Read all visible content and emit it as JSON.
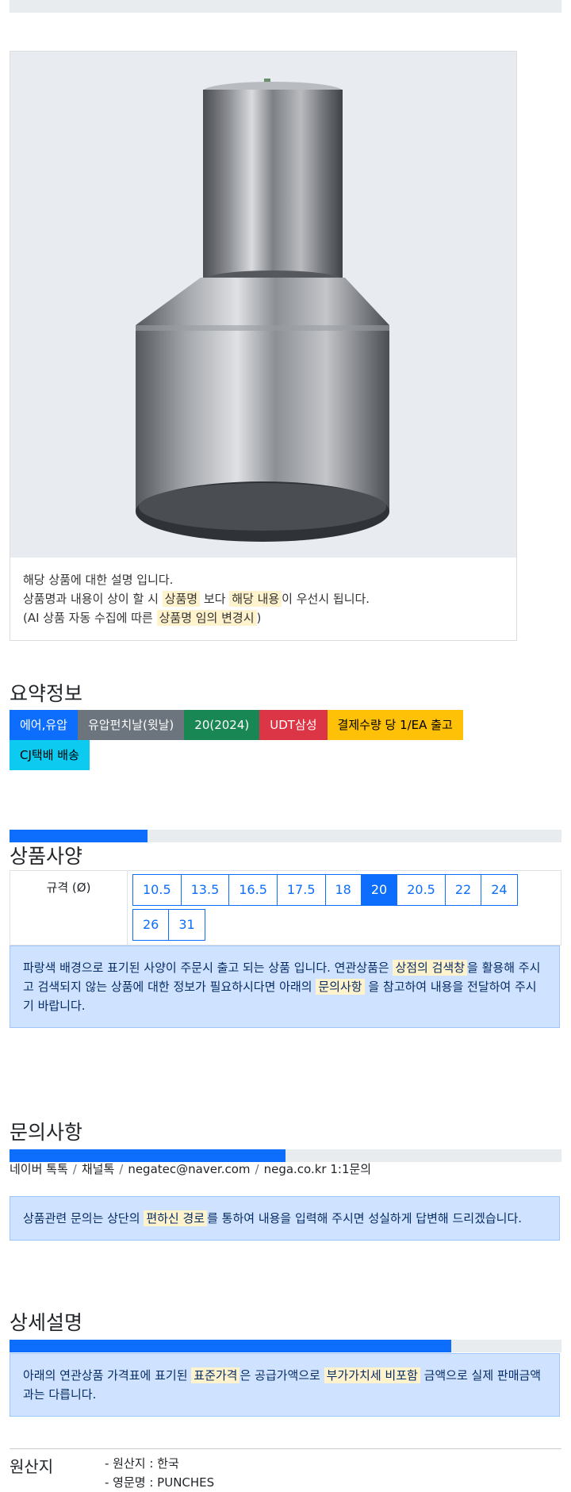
{
  "product": {
    "image_alt": "stainless steel punch",
    "note_line1": "해당 상품에 대한 설명 입니다.",
    "note_line2_a": "상품명과 내용이 상이 할 시 ",
    "note_line2_hl1": "상품명",
    "note_line2_b": " 보다 ",
    "note_line2_hl2": "해당 내용",
    "note_line2_c": "이 우선시 됩니다.",
    "note_line3_a": "(AI 상품 자동 수집에 따른 ",
    "note_line3_hl": "상품명 임의 변경시",
    "note_line3_b": ")"
  },
  "summary": {
    "title": "요약정보",
    "tags": [
      {
        "label": "에어,유압",
        "color": "#0d6efd",
        "text": "#ffffff"
      },
      {
        "label": "유압펀치날(윗날)",
        "color": "#6c757d",
        "text": "#ffffff"
      },
      {
        "label": "20(2024)",
        "color": "#198754",
        "text": "#ffffff"
      },
      {
        "label": "UDT삼성",
        "color": "#dc3545",
        "text": "#ffffff"
      },
      {
        "label": "결제수량 당 1/EA 출고",
        "color": "#ffc107",
        "text": "#000000"
      },
      {
        "label": "CJ택배 배송",
        "color": "#0dcaf0",
        "text": "#000000"
      }
    ]
  },
  "spec": {
    "title": "상품사양",
    "progress": 0.25,
    "label": "규격 (Ø)",
    "options": [
      "10.5",
      "13.5",
      "16.5",
      "17.5",
      "18",
      "20",
      "20.5",
      "22",
      "24",
      "26",
      "31"
    ],
    "selected": "20",
    "info_a": "파랑색 배경으로 표기된 사양이 주문시 출고 되는 상품 입니다. 연관상품은 ",
    "info_hl1": "상점의 검색창",
    "info_b": "을 활용해 주시고 검색되지 않는 상품에 대한 정보가 필요하시다면 아래의 ",
    "info_hl2": "문의사항",
    "info_c": " 을 참고하여 내용을 전달하여 주시기 바랍니다."
  },
  "inquiry": {
    "title": "문의사항",
    "progress": 0.5,
    "contacts": [
      "네이버 톡톡",
      "채널톡",
      "negatec@naver.com",
      "nega.co.kr 1:1문의"
    ],
    "info_a": "상품관련 문의는 상단의 ",
    "info_hl": "편하신 경로",
    "info_b": "를 통하여 내용을 입력해 주시면 성실하게 답변해 드리겠습니다."
  },
  "detail": {
    "title": "상세설명",
    "progress": 0.8,
    "info_a": "아래의 연관상품 가격표에 표기된 ",
    "info_hl1": "표준가격",
    "info_b": "은 공급가액으로 ",
    "info_hl2": "부가가치세 비포함",
    "info_c": " 금액으로 실제 판매금액과는 다릅니다."
  },
  "origin": {
    "label": "원산지",
    "line1": "- 원산지 : 한국",
    "line2": "- 영문명 : PUNCHES"
  }
}
